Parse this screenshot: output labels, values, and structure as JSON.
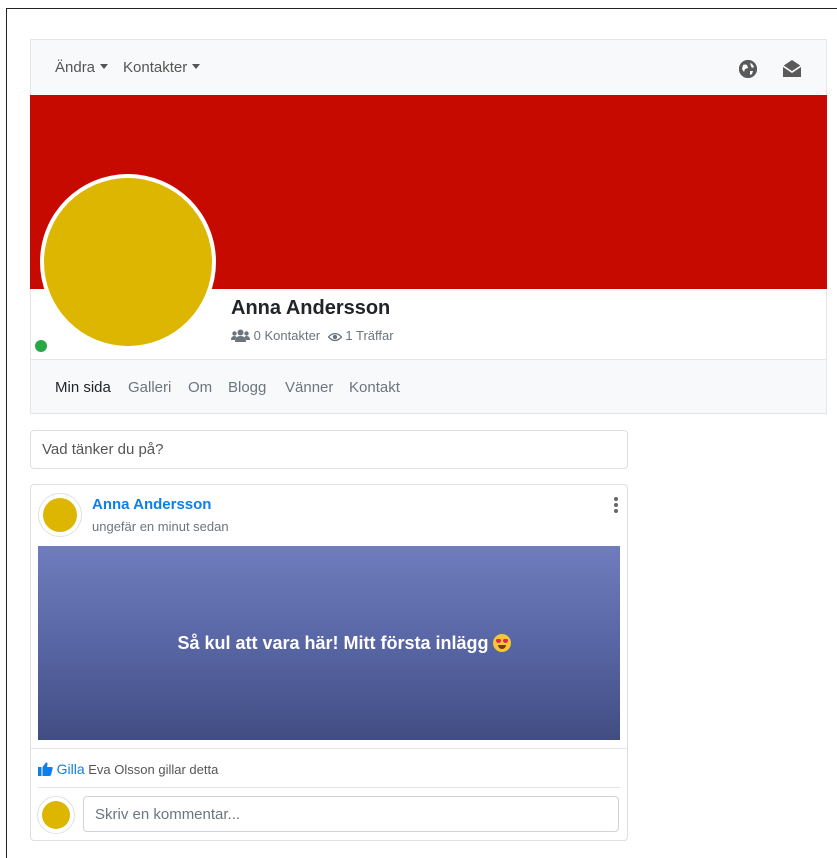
{
  "topnav": {
    "menus": [
      {
        "label": "Ändra"
      },
      {
        "label": "Kontakter"
      }
    ],
    "icons": [
      "globe-icon",
      "envelope-open-icon"
    ]
  },
  "profile": {
    "name": "Anna Andersson",
    "contacts_count": "0",
    "contacts_label": "Kontakter",
    "views_count": "1",
    "views_label": "Träffar",
    "cover_color": "#c70a00",
    "avatar_color": "#dcb600",
    "online_status_color": "#28a745"
  },
  "tabs": [
    {
      "label": "Min sida",
      "active": true
    },
    {
      "label": "Galleri"
    },
    {
      "label": "Om"
    },
    {
      "label": "Blogg"
    },
    {
      "label": "Vänner"
    },
    {
      "label": "Kontakt"
    }
  ],
  "status_box": {
    "placeholder": "Vad tänker du på?"
  },
  "post": {
    "author": "Anna Andersson",
    "time": "ungefär en minut sedan",
    "text": "Så kul att vara här! Mitt första inlägg",
    "emoji": "heart-eyes-emoji",
    "like_label": "Gilla",
    "likes_text": "Eva Olsson gillar detta",
    "comment_placeholder": "Skriv en kommentar..."
  },
  "colors": {
    "link": "#0d7fe8",
    "accent_avatar": "#dcb600"
  }
}
